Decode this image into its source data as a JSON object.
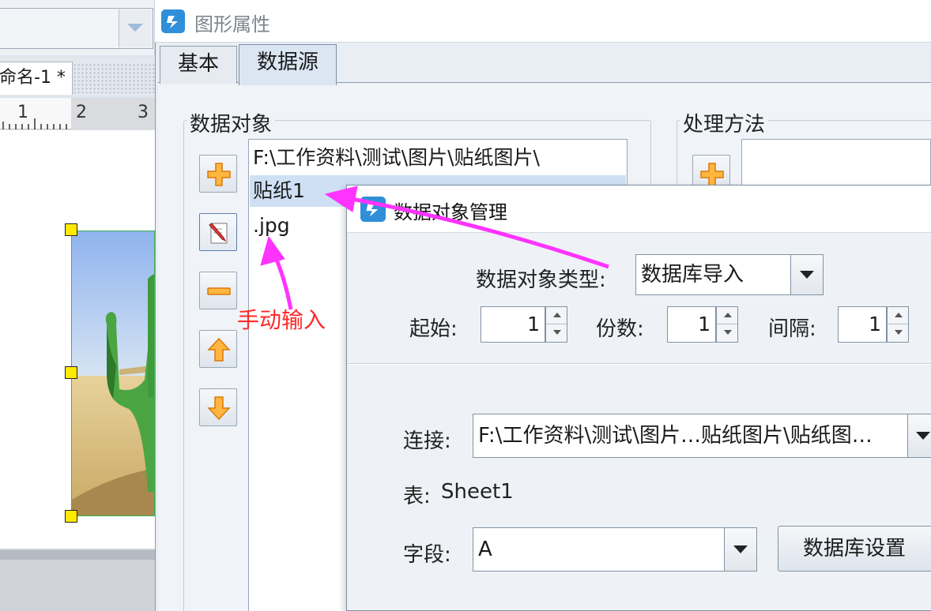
{
  "background_window": {
    "doc_tab_label": "命名-1 *",
    "ruler_marks": [
      "1",
      "2",
      "3"
    ]
  },
  "graphic_properties": {
    "title": "图形属性",
    "tabs": [
      {
        "label": "基本",
        "active": false
      },
      {
        "label": "数据源",
        "active": true
      }
    ],
    "data_object_group_label": "数据对象",
    "processing_group_label": "处理方法",
    "data_items": [
      "F:\\工作资料\\测试\\图片\\贴纸图片\\",
      "贴纸1",
      ".jpg"
    ],
    "selected_item_index": 1,
    "side_buttons": [
      "add-icon",
      "edit-icon",
      "remove-icon",
      "arrow-up-icon",
      "arrow-down-icon"
    ]
  },
  "data_object_manager": {
    "title": "数据对象管理",
    "type_label": "数据对象类型:",
    "type_value": "数据库导入",
    "start_label": "起始:",
    "start_value": "1",
    "copies_label": "份数:",
    "copies_value": "1",
    "interval_label": "间隔:",
    "interval_value": "1",
    "connection_label": "连接:",
    "connection_value": "F:\\工作资料\\测试\\图片…贴纸图片\\贴纸图…",
    "table_label": "表:",
    "table_value": "Sheet1",
    "field_label": "字段:",
    "field_value": "A",
    "db_settings_label": "数据库设置"
  },
  "annotation": {
    "text": "手动输入",
    "text_color": "#ff2a2a",
    "arrow_color": "#ff33ff"
  },
  "colors": {
    "selection": "#cfe0f5",
    "handle": "#ffea00",
    "frame_border": "#3fb34f"
  }
}
